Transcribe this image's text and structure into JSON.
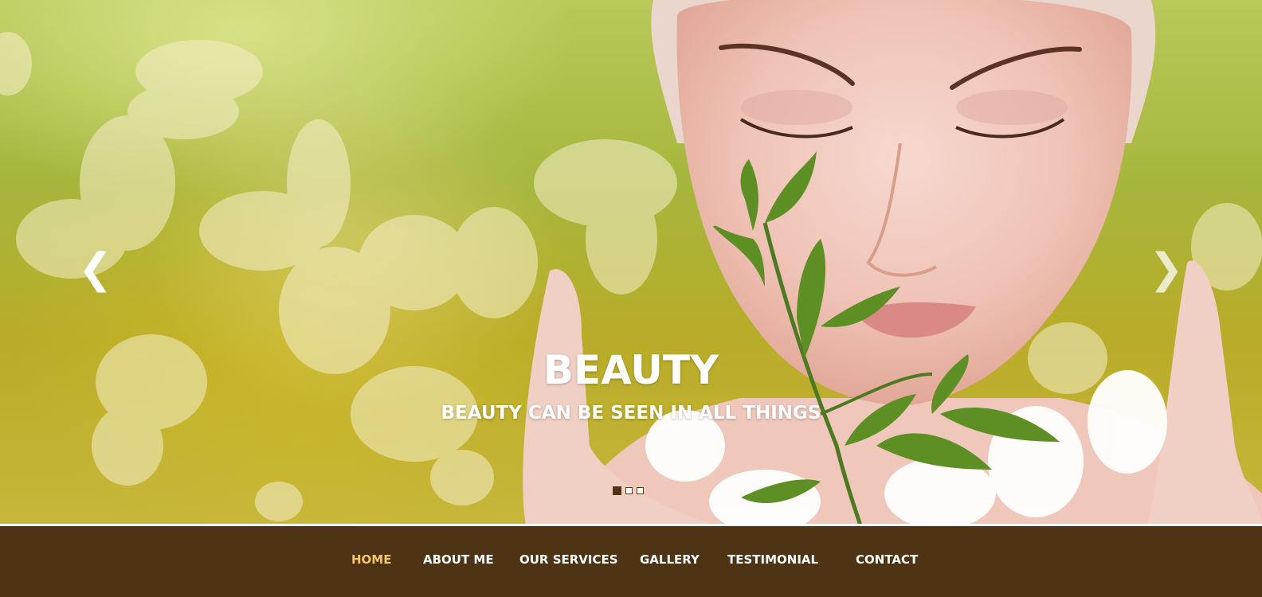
{
  "hero": {
    "title": "BEAUTY",
    "subtitle": "BEAUTY CAN BE SEEN IN ALL THINGS",
    "prev_arrow": "❮",
    "next_arrow": "❯",
    "slides_count": 3,
    "active_slide": 1
  },
  "nav": {
    "items": [
      {
        "label": "HOME",
        "active": true
      },
      {
        "label": "ABOUT ME",
        "active": false
      },
      {
        "label": "OUR SERVICES",
        "active": false
      },
      {
        "label": "GALLERY",
        "active": false
      },
      {
        "label": "TESTIMONIAL",
        "active": false
      },
      {
        "label": "CONTACT",
        "active": false
      }
    ]
  },
  "colors": {
    "nav_background": "#4e3414",
    "nav_active": "#f2c66a",
    "nav_text": "#ffffff",
    "hero_green": "#a6b63c"
  },
  "icons": {
    "prev": "chevron-left-icon",
    "next": "chevron-right-icon"
  }
}
